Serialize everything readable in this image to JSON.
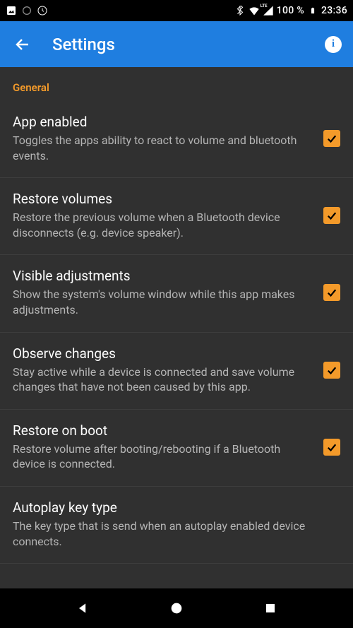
{
  "status": {
    "battery_pct": "100 %",
    "time": "23:36",
    "lte": "LTE"
  },
  "appbar": {
    "title": "Settings"
  },
  "section": {
    "general": "General"
  },
  "items": [
    {
      "title": "App enabled",
      "desc": "Toggles the apps ability to react to volume and bluetooth events.",
      "checked": true
    },
    {
      "title": "Restore volumes",
      "desc": "Restore the previous volume when a Bluetooth device disconnects (e.g. device speaker).",
      "checked": true
    },
    {
      "title": "Visible adjustments",
      "desc": "Show the system's volume window while this app makes adjustments.",
      "checked": true
    },
    {
      "title": "Observe changes",
      "desc": "Stay active while a device is connected and save volume changes that have not been caused by this app.",
      "checked": true
    },
    {
      "title": "Restore on boot",
      "desc": "Restore volume after booting/rebooting if a Bluetooth device is connected.",
      "checked": true
    },
    {
      "title": "Autoplay key type",
      "desc": "The key type that is send when an autoplay enabled device connects.",
      "checked": false
    }
  ]
}
